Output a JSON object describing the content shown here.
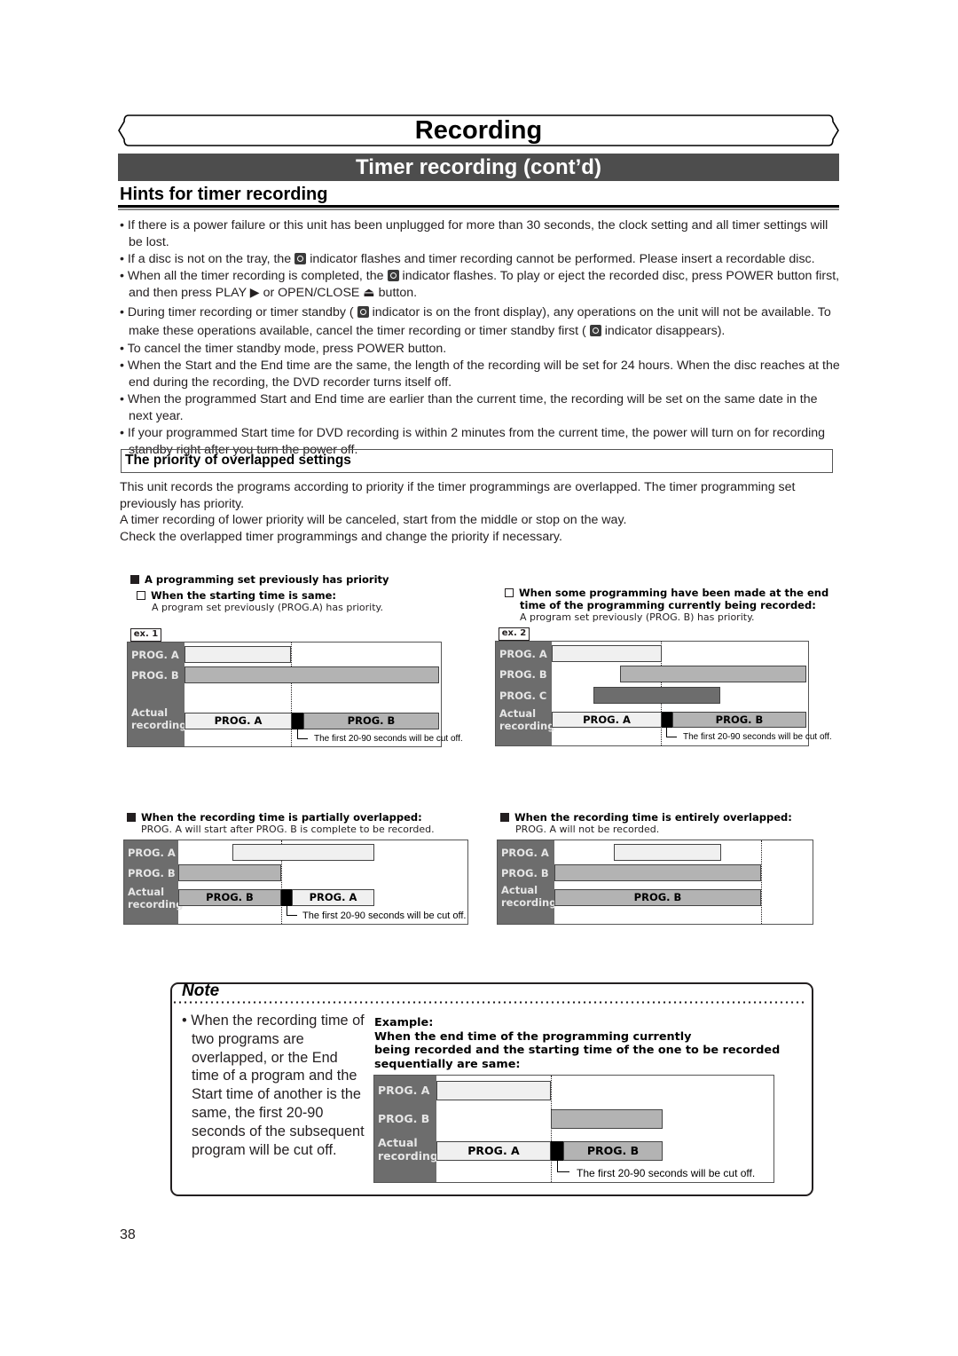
{
  "header": {
    "section_title": "Recording",
    "subsection_title": "Timer recording (cont’d)"
  },
  "hints": {
    "title": "Hints for timer recording",
    "items": [
      {
        "text": "If there is a power failure or this unit has been unplugged for more than 30 seconds, the clock setting and all timer settings will be lost."
      },
      {
        "pre": "If a disc is not on the tray, the",
        "icon": "timer-indicator-icon",
        "post": "indicator flashes and timer recording cannot be performed. Please insert a recordable disc."
      },
      {
        "pre": "When all the timer recording is completed, the",
        "icon": "timer-indicator-icon",
        "post": "indicator flashes. To play or eject the recorded disc, press POWER button first, and then press PLAY ▶ or OPEN/CLOSE ⏏ button."
      },
      {
        "pre": "During timer recording or timer standby (",
        "icon": "timer-indicator-icon",
        "mid": "indicator is on the front display), any operations on the unit will not be available. To make these operations available, cancel the timer recording or timer standby first (",
        "icon2": "timer-indicator-icon",
        "post": "indicator disappears)."
      },
      {
        "text": "To cancel the timer standby mode, press POWER button."
      },
      {
        "text": "When the Start and the End time are the same, the length of the recording will be set for 24 hours. When the disc reaches at the end during the recording, the DVD recorder turns itself off."
      },
      {
        "text": "When the programmed Start and End time are earlier than the current time, the recording will be set on the same date in the next year."
      },
      {
        "text": "If your programmed Start time for DVD recording is within 2 minutes from the current time, the power will turn on for recording standby right after you turn the power off."
      }
    ]
  },
  "priority": {
    "title": "The priority of overlapped settings",
    "paragraphs": [
      "This unit records the programs according to priority if the timer programmings are overlapped. The timer programming set previously has priority.",
      "A timer recording of lower priority will be canceled, start from the middle or stop on the way.",
      "Check the overlapped timer programmings and change the priority if necessary."
    ]
  },
  "diagrams": {
    "common": {
      "prog_a": "PROG. A",
      "prog_b": "PROG. B",
      "prog_c": "PROG. C",
      "actual": "Actual",
      "recording": "recording",
      "cut_note": "The first 20-90 seconds will be cut off."
    },
    "ex1": {
      "group_heading": "A programming set previously has priority",
      "heading": "When the starting time is same:",
      "subtext": "A program set previously (PROG.A) has priority.",
      "label": "ex. 1",
      "actual_bars": [
        "PROG. A",
        "PROG. B"
      ]
    },
    "ex2": {
      "heading_line1": "When some programming have been made at the end",
      "heading_line2": "time of the programming currently being recorded:",
      "subtext": "A program set previously (PROG. B) has priority.",
      "label": "ex. 2",
      "actual_bars": [
        "PROG. A",
        "PROG. B"
      ]
    },
    "partial": {
      "heading": "When the recording time is partially overlapped:",
      "subtext": "PROG. A will start after PROG. B is complete to be recorded.",
      "actual_bars": [
        "PROG. B",
        "PROG. A"
      ]
    },
    "entire": {
      "heading": "When the recording time is entirely overlapped:",
      "subtext": "PROG. A will not be recorded.",
      "actual_bars": [
        "PROG. B"
      ]
    }
  },
  "note": {
    "title": "Note",
    "body": "When the recording time of two programs are overlapped, or the End time of a program and the Start time of another is the same, the first 20-90 seconds of the subsequent program will be cut off.",
    "example_label": "Example:",
    "example_line1": "When the end time of the programming currently",
    "example_line2": "being recorded and the starting time of the one to be recorded",
    "example_line3": "sequentially are same:",
    "actual_bars": [
      "PROG. A",
      "PROG. B"
    ]
  },
  "page_number": "38"
}
